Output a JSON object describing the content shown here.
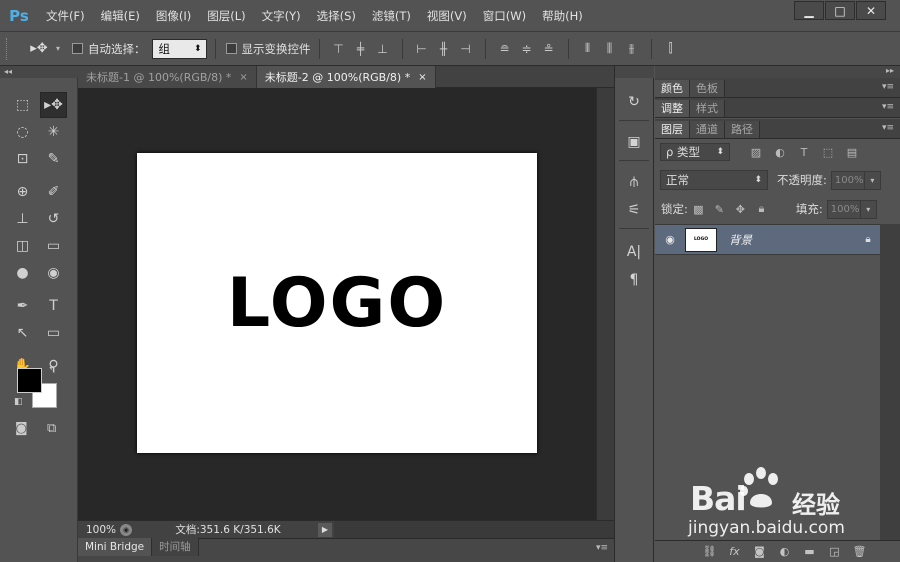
{
  "app": {
    "logo": "Ps",
    "menu": [
      "文件(F)",
      "编辑(E)",
      "图像(I)",
      "图层(L)",
      "文字(Y)",
      "选择(S)",
      "滤镜(T)",
      "视图(V)",
      "窗口(W)",
      "帮助(H)"
    ],
    "window_controls": [
      "▁",
      "□",
      "✕"
    ]
  },
  "options": {
    "tool_glyph": "▸✥",
    "auto_select_label": "自动选择：",
    "auto_select_value": "组",
    "transform_label": "显示变换控件"
  },
  "tabs": [
    {
      "label": "未标题-1 @ 100%(RGB/8) *",
      "close": "×"
    },
    {
      "label": "未标题-2 @ 100%(RGB/8) *",
      "close": "×"
    }
  ],
  "canvas": {
    "text": "LOGO",
    "background": "#ffffff"
  },
  "status": {
    "zoom": "100%",
    "doc_info": "文档:351.6 K/351.6K",
    "arrow": "▶"
  },
  "bottom_panel": {
    "tabs": [
      "Mini Bridge",
      "时间轴"
    ],
    "menu": "▾≡"
  },
  "right_panels": {
    "group1_tabs": [
      "颜色",
      "色板"
    ],
    "group2_tabs": [
      "调整",
      "样式"
    ],
    "group3_tabs": [
      "图层",
      "通道",
      "路径"
    ],
    "menu": "▾≡",
    "collapse": "▸▸"
  },
  "layers": {
    "filter_label": "ρ 类型",
    "blend_mode": "正常",
    "opacity_label": "不透明度:",
    "opacity_value": "100%",
    "lock_label": "锁定:",
    "fill_label": "填充:",
    "fill_value": "100%",
    "items": [
      {
        "name": "背景",
        "thumb_text": "LOGO",
        "locked": true
      }
    ]
  },
  "watermark": {
    "brand": "Bai",
    "brand_cn": "经验",
    "url": "jingyan.baidu.com"
  },
  "colors": {
    "accent": "#4fb0e8",
    "selected_layer": "#5d6a7e",
    "canvas_bg": "#282828",
    "foreground": "#000000",
    "background": "#ffffff"
  }
}
